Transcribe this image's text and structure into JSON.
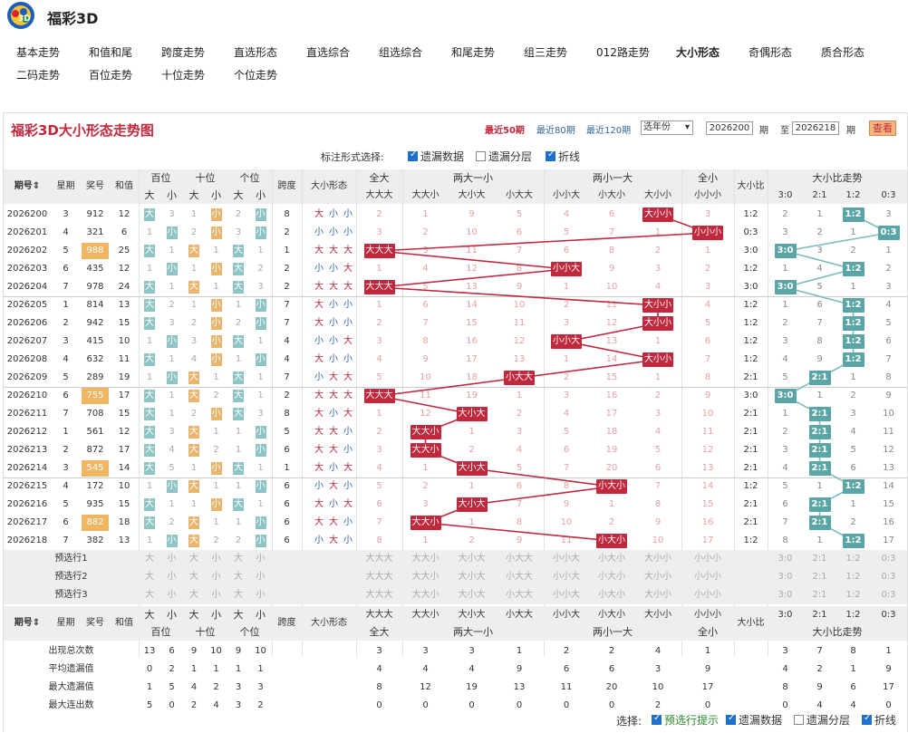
{
  "app": {
    "title": "福彩3D"
  },
  "nav": {
    "items": [
      "基本走势",
      "和值和尾",
      "跨度走势",
      "直选形态",
      "直选综合",
      "组选综合",
      "和尾走势",
      "组三走势",
      "012路走势",
      "大小形态",
      "奇偶形态",
      "质合形态",
      "二码走势",
      "百位走势",
      "十位走势",
      "个位走势"
    ],
    "active": "大小形态"
  },
  "panel": {
    "title": "福彩3D大小形态走势图",
    "periods": [
      "最近50期",
      "最近80期",
      "最近120期"
    ],
    "active_period": "最近50期",
    "year_select": "选年份",
    "from": "2026200",
    "from_suffix": "期",
    "to_label": "至",
    "to": "2026218",
    "to_suffix": "期",
    "view_button": "查看"
  },
  "label_options": {
    "prompt": "标注形式选择:",
    "items": [
      {
        "label": "遗漏数据",
        "checked": true
      },
      {
        "label": "遗漏分层",
        "checked": false
      },
      {
        "label": "折线",
        "checked": true
      }
    ]
  },
  "table": {
    "headers": {
      "issue": "期号⇕",
      "week": "星期",
      "prize": "奖号",
      "sum": "和值",
      "bai": "百位",
      "shi": "十位",
      "ge": "个位",
      "big": "大",
      "small": "小",
      "span": "跨度",
      "shape": "大小形态",
      "allbig": "全大",
      "twobig": "两大一小",
      "twosmall": "两小一大",
      "allsmall": "全小",
      "ratio": "大小比",
      "trend": "大小比走势"
    },
    "shape_cols": [
      "大大大",
      "大大小",
      "大小大",
      "小大大",
      "小小大",
      "小大小",
      "大小小",
      "小小小"
    ],
    "ratio_cols": [
      "3:0",
      "2:1",
      "1:2",
      "0:3"
    ],
    "rows": [
      {
        "issue": "2026200",
        "week": "3",
        "prize": "912",
        "sum": "12",
        "prize_hl": false,
        "bai": "大",
        "bai_m": "3",
        "shi": "1",
        "shi_m": "小",
        "ge": "2",
        "ge_m": "小",
        "span": "8",
        "shape": [
          "大",
          "小",
          "小"
        ],
        "shapes": [
          "2",
          "1",
          "9",
          "5",
          "4",
          "6",
          "大小小",
          "3"
        ],
        "ratio": "1:2",
        "trend": [
          "2",
          "1",
          "1:2",
          "3"
        ]
      },
      {
        "issue": "2026201",
        "week": "4",
        "prize": "321",
        "sum": "6",
        "prize_hl": false,
        "bai": "1",
        "bai_m": "小",
        "shi": "2",
        "shi_m": "小",
        "ge": "3",
        "ge_m": "小",
        "span": "2",
        "shape": [
          "小",
          "小",
          "小"
        ],
        "shapes": [
          "3",
          "2",
          "10",
          "6",
          "5",
          "7",
          "1",
          "小小小"
        ],
        "ratio": "0:3",
        "trend": [
          "3",
          "2",
          "1",
          "0:3"
        ]
      },
      {
        "issue": "2026202",
        "week": "5",
        "prize": "988",
        "sum": "25",
        "prize_hl": true,
        "bai": "大",
        "bai_m": "1",
        "shi": "大",
        "shi_m": "1",
        "ge": "大",
        "ge_m": "1",
        "span": "1",
        "shape": [
          "大",
          "大",
          "大"
        ],
        "shapes": [
          "大大大",
          "3",
          "11",
          "7",
          "6",
          "8",
          "2",
          "1"
        ],
        "ratio": "3:0",
        "trend": [
          "3:0",
          "3",
          "2",
          "1"
        ]
      },
      {
        "issue": "2026203",
        "week": "6",
        "prize": "435",
        "sum": "12",
        "prize_hl": false,
        "bai": "1",
        "bai_m": "小",
        "shi": "1",
        "shi_m": "小",
        "ge": "大",
        "ge_m": "2",
        "span": "2",
        "shape": [
          "小",
          "小",
          "大"
        ],
        "shapes": [
          "1",
          "4",
          "12",
          "8",
          "小小大",
          "9",
          "3",
          "2"
        ],
        "ratio": "1:2",
        "trend": [
          "1",
          "4",
          "1:2",
          "2"
        ]
      },
      {
        "issue": "2026204",
        "week": "7",
        "prize": "978",
        "sum": "24",
        "prize_hl": false,
        "bai": "大",
        "bai_m": "1",
        "shi": "大",
        "shi_m": "1",
        "ge": "大",
        "ge_m": "3",
        "span": "2",
        "shape": [
          "大",
          "大",
          "大"
        ],
        "shapes": [
          "大大大",
          "5",
          "13",
          "9",
          "1",
          "10",
          "4",
          "3"
        ],
        "ratio": "3:0",
        "trend": [
          "3:0",
          "5",
          "1",
          "3"
        ]
      },
      {
        "issue": "2026205",
        "week": "1",
        "prize": "814",
        "sum": "13",
        "prize_hl": false,
        "bai": "大",
        "bai_m": "2",
        "shi": "1",
        "shi_m": "小",
        "ge": "1",
        "ge_m": "小",
        "span": "7",
        "shape": [
          "大",
          "小",
          "小"
        ],
        "shapes": [
          "1",
          "6",
          "14",
          "10",
          "2",
          "11",
          "大小小",
          "4"
        ],
        "ratio": "1:2",
        "trend": [
          "1",
          "6",
          "1:2",
          "4"
        ]
      },
      {
        "issue": "2026206",
        "week": "2",
        "prize": "942",
        "sum": "15",
        "prize_hl": false,
        "bai": "大",
        "bai_m": "3",
        "shi": "2",
        "shi_m": "小",
        "ge": "2",
        "ge_m": "小",
        "span": "7",
        "shape": [
          "大",
          "小",
          "小"
        ],
        "shapes": [
          "2",
          "7",
          "15",
          "11",
          "3",
          "12",
          "大小小",
          "5"
        ],
        "ratio": "1:2",
        "trend": [
          "2",
          "7",
          "1:2",
          "5"
        ]
      },
      {
        "issue": "2026207",
        "week": "3",
        "prize": "415",
        "sum": "10",
        "prize_hl": false,
        "bai": "1",
        "bai_m": "小",
        "shi": "3",
        "shi_m": "小",
        "ge": "大",
        "ge_m": "1",
        "span": "4",
        "shape": [
          "小",
          "小",
          "大"
        ],
        "shapes": [
          "3",
          "8",
          "16",
          "12",
          "小小大",
          "13",
          "1",
          "6"
        ],
        "ratio": "1:2",
        "trend": [
          "3",
          "8",
          "1:2",
          "6"
        ]
      },
      {
        "issue": "2026208",
        "week": "4",
        "prize": "632",
        "sum": "11",
        "prize_hl": false,
        "bai": "大",
        "bai_m": "1",
        "shi": "4",
        "shi_m": "小",
        "ge": "1",
        "ge_m": "小",
        "span": "4",
        "shape": [
          "大",
          "小",
          "小"
        ],
        "shapes": [
          "4",
          "9",
          "17",
          "13",
          "1",
          "14",
          "大小小",
          "7"
        ],
        "ratio": "1:2",
        "trend": [
          "4",
          "9",
          "1:2",
          "7"
        ]
      },
      {
        "issue": "2026209",
        "week": "5",
        "prize": "289",
        "sum": "19",
        "prize_hl": false,
        "bai": "1",
        "bai_m": "小",
        "shi": "大",
        "shi_m": "1",
        "ge": "大",
        "ge_m": "1",
        "span": "7",
        "shape": [
          "小",
          "大",
          "大"
        ],
        "shapes": [
          "5",
          "10",
          "18",
          "小大大",
          "2",
          "15",
          "1",
          "8"
        ],
        "ratio": "2:1",
        "trend": [
          "5",
          "2:1",
          "1",
          "8"
        ]
      },
      {
        "issue": "2026210",
        "week": "6",
        "prize": "755",
        "sum": "17",
        "prize_hl": true,
        "bai": "大",
        "bai_m": "1",
        "shi": "大",
        "shi_m": "2",
        "ge": "大",
        "ge_m": "1",
        "span": "2",
        "shape": [
          "大",
          "大",
          "大"
        ],
        "shapes": [
          "大大大",
          "11",
          "19",
          "1",
          "3",
          "16",
          "2",
          "9"
        ],
        "ratio": "3:0",
        "trend": [
          "3:0",
          "1",
          "2",
          "9"
        ]
      },
      {
        "issue": "2026211",
        "week": "7",
        "prize": "708",
        "sum": "15",
        "prize_hl": false,
        "bai": "大",
        "bai_m": "1",
        "shi": "2",
        "shi_m": "小",
        "ge": "大",
        "ge_m": "3",
        "span": "8",
        "shape": [
          "大",
          "小",
          "大"
        ],
        "shapes": [
          "1",
          "12",
          "大小大",
          "2",
          "4",
          "17",
          "3",
          "10"
        ],
        "ratio": "2:1",
        "trend": [
          "1",
          "2:1",
          "3",
          "10"
        ]
      },
      {
        "issue": "2026212",
        "week": "1",
        "prize": "561",
        "sum": "12",
        "prize_hl": false,
        "bai": "大",
        "bai_m": "3",
        "shi": "大",
        "shi_m": "1",
        "ge": "1",
        "ge_m": "小",
        "span": "5",
        "shape": [
          "大",
          "大",
          "小"
        ],
        "shapes": [
          "2",
          "大大小",
          "1",
          "3",
          "5",
          "18",
          "4",
          "11"
        ],
        "ratio": "2:1",
        "trend": [
          "2",
          "2:1",
          "4",
          "11"
        ]
      },
      {
        "issue": "2026213",
        "week": "2",
        "prize": "872",
        "sum": "17",
        "prize_hl": false,
        "bai": "大",
        "bai_m": "4",
        "shi": "大",
        "shi_m": "2",
        "ge": "1",
        "ge_m": "小",
        "span": "6",
        "shape": [
          "大",
          "大",
          "小"
        ],
        "shapes": [
          "3",
          "大大小",
          "2",
          "4",
          "6",
          "19",
          "5",
          "12"
        ],
        "ratio": "2:1",
        "trend": [
          "3",
          "2:1",
          "5",
          "12"
        ]
      },
      {
        "issue": "2026214",
        "week": "3",
        "prize": "545",
        "sum": "14",
        "prize_hl": true,
        "bai": "大",
        "bai_m": "5",
        "shi": "1",
        "shi_m": "小",
        "ge": "大",
        "ge_m": "1",
        "span": "1",
        "shape": [
          "大",
          "小",
          "大"
        ],
        "shapes": [
          "4",
          "1",
          "大小大",
          "5",
          "7",
          "20",
          "6",
          "13"
        ],
        "ratio": "2:1",
        "trend": [
          "4",
          "2:1",
          "6",
          "13"
        ]
      },
      {
        "issue": "2026215",
        "week": "4",
        "prize": "172",
        "sum": "10",
        "prize_hl": false,
        "bai": "1",
        "bai_m": "小",
        "shi": "大",
        "shi_m": "1",
        "ge": "1",
        "ge_m": "小",
        "span": "6",
        "shape": [
          "小",
          "大",
          "小"
        ],
        "shapes": [
          "5",
          "2",
          "1",
          "6",
          "8",
          "小大小",
          "7",
          "14"
        ],
        "ratio": "1:2",
        "trend": [
          "5",
          "1",
          "1:2",
          "14"
        ]
      },
      {
        "issue": "2026216",
        "week": "5",
        "prize": "935",
        "sum": "15",
        "prize_hl": false,
        "bai": "大",
        "bai_m": "1",
        "shi": "1",
        "shi_m": "小",
        "ge": "大",
        "ge_m": "1",
        "span": "6",
        "shape": [
          "大",
          "小",
          "大"
        ],
        "shapes": [
          "6",
          "3",
          "大小大",
          "7",
          "9",
          "1",
          "8",
          "15"
        ],
        "ratio": "2:1",
        "trend": [
          "6",
          "2:1",
          "1",
          "15"
        ]
      },
      {
        "issue": "2026217",
        "week": "6",
        "prize": "882",
        "sum": "18",
        "prize_hl": true,
        "bai": "大",
        "bai_m": "2",
        "shi": "大",
        "shi_m": "1",
        "ge": "1",
        "ge_m": "小",
        "span": "6",
        "shape": [
          "大",
          "大",
          "小"
        ],
        "shapes": [
          "7",
          "大大小",
          "1",
          "8",
          "10",
          "2",
          "9",
          "16"
        ],
        "ratio": "2:1",
        "trend": [
          "7",
          "2:1",
          "2",
          "16"
        ]
      },
      {
        "issue": "2026218",
        "week": "7",
        "prize": "382",
        "sum": "13",
        "prize_hl": false,
        "bai": "1",
        "bai_m": "小",
        "shi": "大",
        "shi_m": "2",
        "ge": "2",
        "ge_m": "小",
        "span": "6",
        "shape": [
          "小",
          "大",
          "小"
        ],
        "shapes": [
          "8",
          "1",
          "2",
          "9",
          "11",
          "小大小",
          "10",
          "17"
        ],
        "ratio": "1:2",
        "trend": [
          "8",
          "1",
          "1:2",
          "17"
        ]
      }
    ],
    "preselect": [
      "预选行1",
      "预选行2",
      "预选行3"
    ],
    "stats": [
      {
        "label": "出现总次数",
        "pos": [
          "13",
          "6",
          "9",
          "10",
          "9",
          "10"
        ],
        "shapes": [
          "3",
          "3",
          "3",
          "1",
          "2",
          "2",
          "4",
          "1"
        ],
        "trend": [
          "3",
          "7",
          "8",
          "1"
        ]
      },
      {
        "label": "平均遗漏值",
        "pos": [
          "0",
          "2",
          "1",
          "1",
          "1",
          "1"
        ],
        "shapes": [
          "4",
          "4",
          "4",
          "9",
          "6",
          "6",
          "3",
          "9"
        ],
        "trend": [
          "4",
          "2",
          "1",
          "9"
        ]
      },
      {
        "label": "最大遗漏值",
        "pos": [
          "1",
          "5",
          "4",
          "2",
          "3",
          "3"
        ],
        "shapes": [
          "8",
          "12",
          "19",
          "13",
          "11",
          "20",
          "10",
          "17"
        ],
        "trend": [
          "8",
          "9",
          "6",
          "17"
        ]
      },
      {
        "label": "最大连出数",
        "pos": [
          "5",
          "0",
          "2",
          "4",
          "3",
          "2"
        ],
        "shapes": [
          "0",
          "0",
          "0",
          "0",
          "0",
          "0",
          "2",
          "0"
        ],
        "trend": [
          "0",
          "4",
          "4",
          "0"
        ]
      }
    ]
  },
  "bottom": {
    "prompt": "选择:",
    "items": [
      {
        "label": "预选行提示",
        "checked": true,
        "color": "#2a8a2a"
      },
      {
        "label": "遗漏数据",
        "checked": true
      },
      {
        "label": "遗漏分层",
        "checked": false
      },
      {
        "label": "折线",
        "checked": true
      }
    ]
  },
  "colors": {
    "red": "#c0283d",
    "teal": "#8fc4c4",
    "teal_dark": "#5aa6a6",
    "orange": "#e8b56e",
    "gray_head": "#eeeeee",
    "line_red": "#c0283d",
    "line_teal": "#7fbcbc"
  }
}
